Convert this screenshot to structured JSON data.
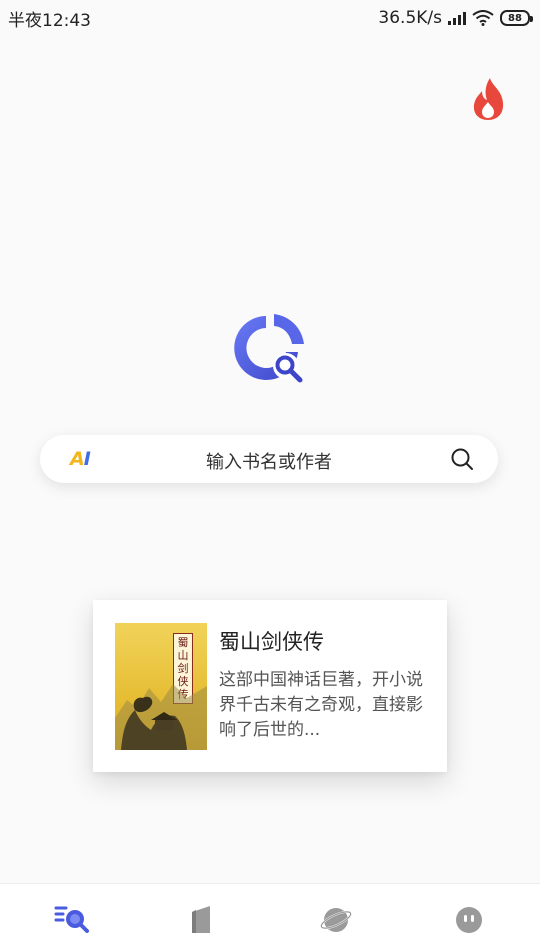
{
  "status_bar": {
    "time": "半夜12:43",
    "network_speed": "36.5K/s",
    "battery": "88"
  },
  "icons": {
    "hot": "flame-icon",
    "logo": "app-logo",
    "ai": "ai-badge",
    "search": "search-icon"
  },
  "colors": {
    "accent": "#4a5be0",
    "flame": "#e8473c",
    "ai_yellow": "#f2b51b",
    "ai_blue": "#3f6de3"
  },
  "search": {
    "ai_label_a": "A",
    "ai_label_i": "I",
    "placeholder": "输入书名或作者"
  },
  "recommendation": {
    "title": "蜀山剑侠传",
    "cover_title": "蜀山剑侠传",
    "description": "这部中国神话巨著，开小说界千古未有之奇观，直接影响了后世的..."
  },
  "bottom_nav": [
    {
      "icon": "search-icon",
      "active": true
    },
    {
      "icon": "bookshelf-icon",
      "active": false
    },
    {
      "icon": "planet-icon",
      "active": false
    },
    {
      "icon": "profile-icon",
      "active": false
    }
  ]
}
